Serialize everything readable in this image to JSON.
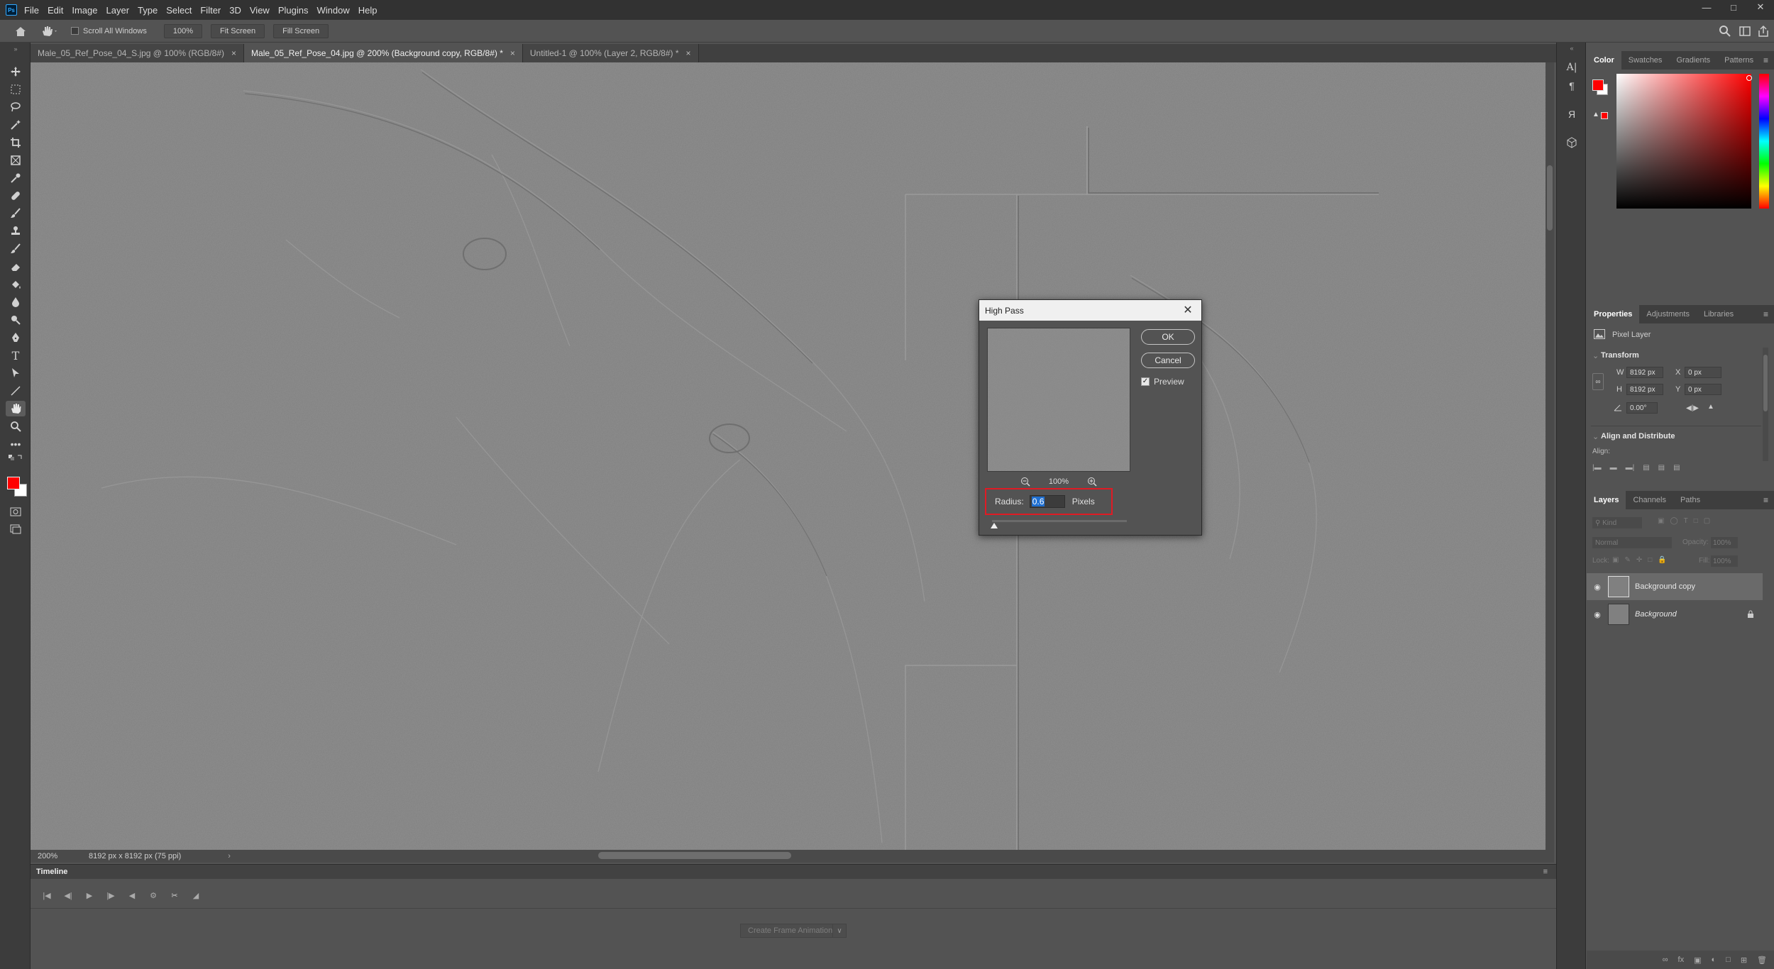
{
  "app": {
    "logo": "Ps",
    "menu": [
      "File",
      "Edit",
      "Image",
      "Layer",
      "Type",
      "Select",
      "Filter",
      "3D",
      "View",
      "Plugins",
      "Window",
      "Help"
    ]
  },
  "options_bar": {
    "scroll_all_windows": "Scroll All Windows",
    "zoom_value": "100%",
    "fit_screen": "Fit Screen",
    "fill_screen": "Fill Screen"
  },
  "tabs": [
    {
      "label": "Male_05_Ref_Pose_04_S.jpg @ 100% (RGB/8#)",
      "active": false
    },
    {
      "label": "Male_05_Ref_Pose_04.jpg @ 200% (Background copy, RGB/8#) *",
      "active": true
    },
    {
      "label": "Untitled-1 @ 100% (Layer 2, RGB/8#) *",
      "active": false
    }
  ],
  "status": {
    "zoom": "200%",
    "doc_info": "8192 px x 8192 px (75 ppi)"
  },
  "timeline": {
    "title": "Timeline",
    "create_button": "Create Frame Animation"
  },
  "dialog": {
    "title": "High Pass",
    "ok": "OK",
    "cancel": "Cancel",
    "preview_label": "Preview",
    "preview_checked": true,
    "zoom": "100%",
    "radius_label": "Radius:",
    "radius_value": "0.6",
    "radius_unit": "Pixels"
  },
  "color_panel": {
    "tabs": [
      "Color",
      "Swatches",
      "Gradients",
      "Patterns"
    ],
    "foreground": "#ff0000",
    "background": "#ffffff"
  },
  "properties_panel": {
    "tabs": [
      "Properties",
      "Adjustments",
      "Libraries"
    ],
    "layer_type": "Pixel Layer",
    "transform_title": "Transform",
    "w_label": "W",
    "w_value": "8192 px",
    "h_label": "H",
    "h_value": "8192 px",
    "x_label": "X",
    "x_value": "0 px",
    "y_label": "Y",
    "y_value": "0 px",
    "angle_value": "0.00°",
    "align_title": "Align and Distribute",
    "align_label": "Align:"
  },
  "layers_panel": {
    "tabs": [
      "Layers",
      "Channels",
      "Paths"
    ],
    "kind_placeholder": "Kind",
    "blend_mode": "Normal",
    "opacity_label": "Opacity:",
    "opacity_value": "100%",
    "lock_label": "Lock:",
    "fill_label": "Fill:",
    "fill_value": "100%",
    "layers": [
      {
        "name": "Background copy",
        "selected": true,
        "locked": false
      },
      {
        "name": "Background",
        "selected": false,
        "locked": true
      }
    ]
  }
}
